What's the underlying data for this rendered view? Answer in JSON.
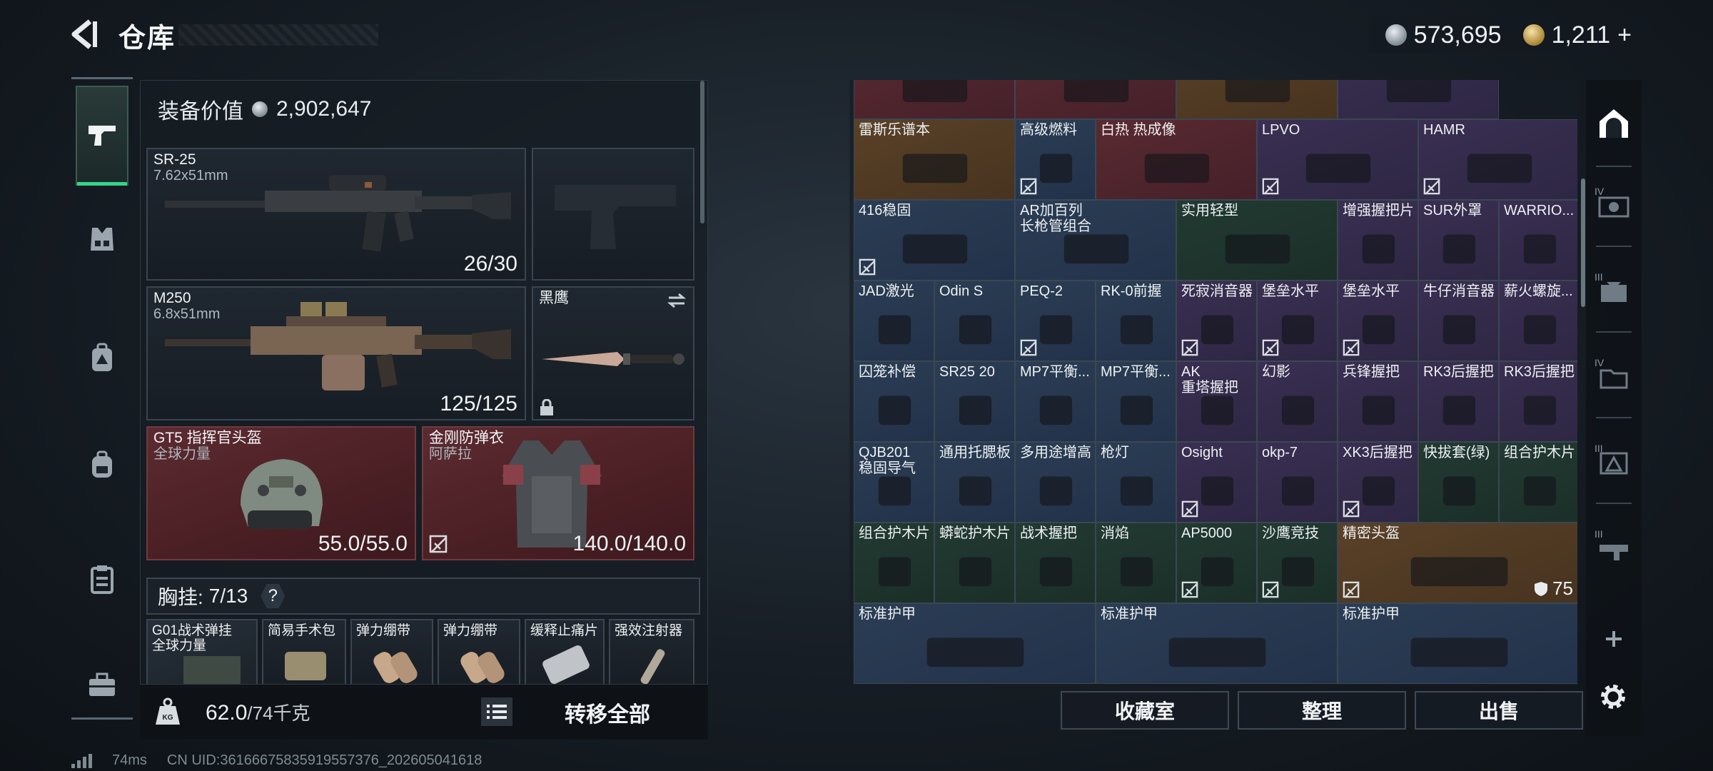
{
  "header": {
    "title": "仓库",
    "currency": [
      {
        "icon": "silver-coin-icon",
        "value": "573,695"
      },
      {
        "icon": "gold-coin-icon",
        "value": "1,211",
        "suffix": "+"
      }
    ]
  },
  "category_rail": {
    "items": [
      {
        "icon": "gun-icon",
        "active": true
      },
      {
        "icon": "vest-icon"
      },
      {
        "icon": "backpack-armor-icon"
      },
      {
        "icon": "backpack-icon"
      },
      {
        "icon": "clipboard-icon"
      },
      {
        "icon": "briefcase-icon"
      }
    ]
  },
  "equipment": {
    "value_label": "装备价值",
    "value": "2,902,647",
    "primary_weapon": {
      "name": "SR-25",
      "caliber": "7.62x51mm",
      "ammo": "26/30"
    },
    "secondary_weapon": {
      "name": "M250",
      "caliber": "6.8x51mm",
      "ammo": "125/125"
    },
    "melee": {
      "name": "黑鹰"
    },
    "helmet": {
      "name": "GT5 指挥官头盔",
      "sub": "全球力量",
      "durability": "55.0/55.0"
    },
    "armor": {
      "name": "金刚防弹衣",
      "sub": "阿萨拉",
      "durability": "140.0/140.0"
    },
    "chest_rig": {
      "label": "胸挂:",
      "count": "7/13",
      "help": "?"
    },
    "rig_items": [
      {
        "name": "G01战术弹挂",
        "sub": "全球力量"
      },
      {
        "name": "简易手术包"
      },
      {
        "name": "弹力绷带"
      },
      {
        "name": "弹力绷带"
      },
      {
        "name": "缓释止痛片"
      },
      {
        "name": "强效注射器"
      }
    ]
  },
  "footer_left": {
    "weight": "62.0",
    "weight_max": "/74千克",
    "transfer_all": "转移全部"
  },
  "grid": {
    "rows": [
      [
        {
          "label": "",
          "bg": "red"
        },
        {
          "label": "",
          "bg": "red"
        },
        {
          "label": "",
          "bg": "gold"
        },
        {
          "label": "",
          "bg": "purple"
        }
      ],
      [
        {
          "label": "雷斯乐谱本",
          "bg": "gold"
        },
        {
          "label": "高级燃料",
          "bg": "blue",
          "noins": true
        },
        {
          "label": "白热 热成像",
          "bg": "red"
        },
        {
          "label": "LPVO",
          "bg": "purple",
          "noins": true
        },
        {
          "label": "HAMR",
          "bg": "purple",
          "noins": true
        }
      ],
      [
        {
          "label": "416稳固",
          "bg": "blue",
          "noins": true
        },
        {
          "label": "AR加百列\n长枪管组合",
          "bg": "blue"
        },
        {
          "label": "实用轻型",
          "bg": "green"
        },
        {
          "label": "增强握把片",
          "bg": "purple"
        },
        {
          "label": "SUR外罩",
          "bg": "purple"
        },
        {
          "label": "WARRIO...",
          "bg": "purple"
        }
      ],
      [
        {
          "label": "JAD激光",
          "bg": "blue"
        },
        {
          "label": "Odin S",
          "bg": "blue"
        },
        {
          "label": "PEQ-2",
          "bg": "blue",
          "noins": true
        },
        {
          "label": "RK-0前握",
          "bg": "blue"
        },
        {
          "label": "死寂消音器",
          "bg": "purple",
          "noins": true
        },
        {
          "label": "堡垒水平",
          "bg": "purple",
          "noins": true
        },
        {
          "label": "堡垒水平",
          "bg": "purple",
          "noins": true
        },
        {
          "label": "牛仔消音器",
          "bg": "purple"
        },
        {
          "label": "薪火螺旋...",
          "bg": "purple"
        }
      ],
      [
        {
          "label": "囚笼补偿",
          "bg": "blue"
        },
        {
          "label": "SR25 20",
          "bg": "blue"
        },
        {
          "label": "MP7平衡...",
          "bg": "blue"
        },
        {
          "label": "MP7平衡...",
          "bg": "blue"
        },
        {
          "label": "AK\n重塔握把",
          "bg": "purple"
        },
        {
          "label": "幻影",
          "bg": "purple"
        },
        {
          "label": "兵锋握把",
          "bg": "purple"
        },
        {
          "label": "RK3后握把",
          "bg": "purple"
        },
        {
          "label": "RK3后握把",
          "bg": "purple"
        }
      ],
      [
        {
          "label": "QJB201\n稳固导气",
          "bg": "blue"
        },
        {
          "label": "通用托腮板",
          "bg": "blue"
        },
        {
          "label": "多用途增高",
          "bg": "blue"
        },
        {
          "label": "枪灯",
          "bg": "blue"
        },
        {
          "label": "Osight",
          "bg": "purple",
          "noins": true
        },
        {
          "label": "okp-7",
          "bg": "purple"
        },
        {
          "label": "XK3后握把",
          "bg": "purple",
          "noins": true
        },
        {
          "label": "快拔套(绿)",
          "bg": "green"
        },
        {
          "label": "组合护木片",
          "bg": "green"
        }
      ],
      [
        {
          "label": "组合护木片",
          "bg": "green"
        },
        {
          "label": "蟒蛇护木片",
          "bg": "green"
        },
        {
          "label": "战术握把",
          "bg": "green"
        },
        {
          "label": "消焰",
          "bg": "green"
        },
        {
          "label": "AP5000",
          "bg": "green",
          "noins": true
        },
        {
          "label": "沙鹰竞技",
          "bg": "green",
          "noins": true
        },
        {
          "label": "精密头盔",
          "bg": "gold",
          "noins": true,
          "value": "75"
        }
      ],
      [
        {
          "label": "标准护甲",
          "bg": "blue"
        },
        {
          "label": "标准护甲",
          "bg": "blue"
        },
        {
          "label": "标准护甲",
          "bg": "blue"
        }
      ]
    ]
  },
  "footer_right": {
    "collection": "收藏室",
    "sort": "整理",
    "sell": "出售"
  },
  "side_rail": {
    "items": [
      {
        "icon": "safe-house-icon"
      },
      {
        "tier": "IV",
        "icon": "workbench-icon"
      },
      {
        "tier": "III",
        "icon": "tech-center-icon"
      },
      {
        "tier": "IV",
        "icon": "storage-icon"
      },
      {
        "tier": "III",
        "icon": "medical-station-icon"
      },
      {
        "tier": "III",
        "icon": "armory-icon"
      },
      {
        "icon": "plus-icon"
      }
    ]
  },
  "status": {
    "ping": "74ms",
    "uid": "CN UID:3616667583591955737б_202605041618"
  }
}
